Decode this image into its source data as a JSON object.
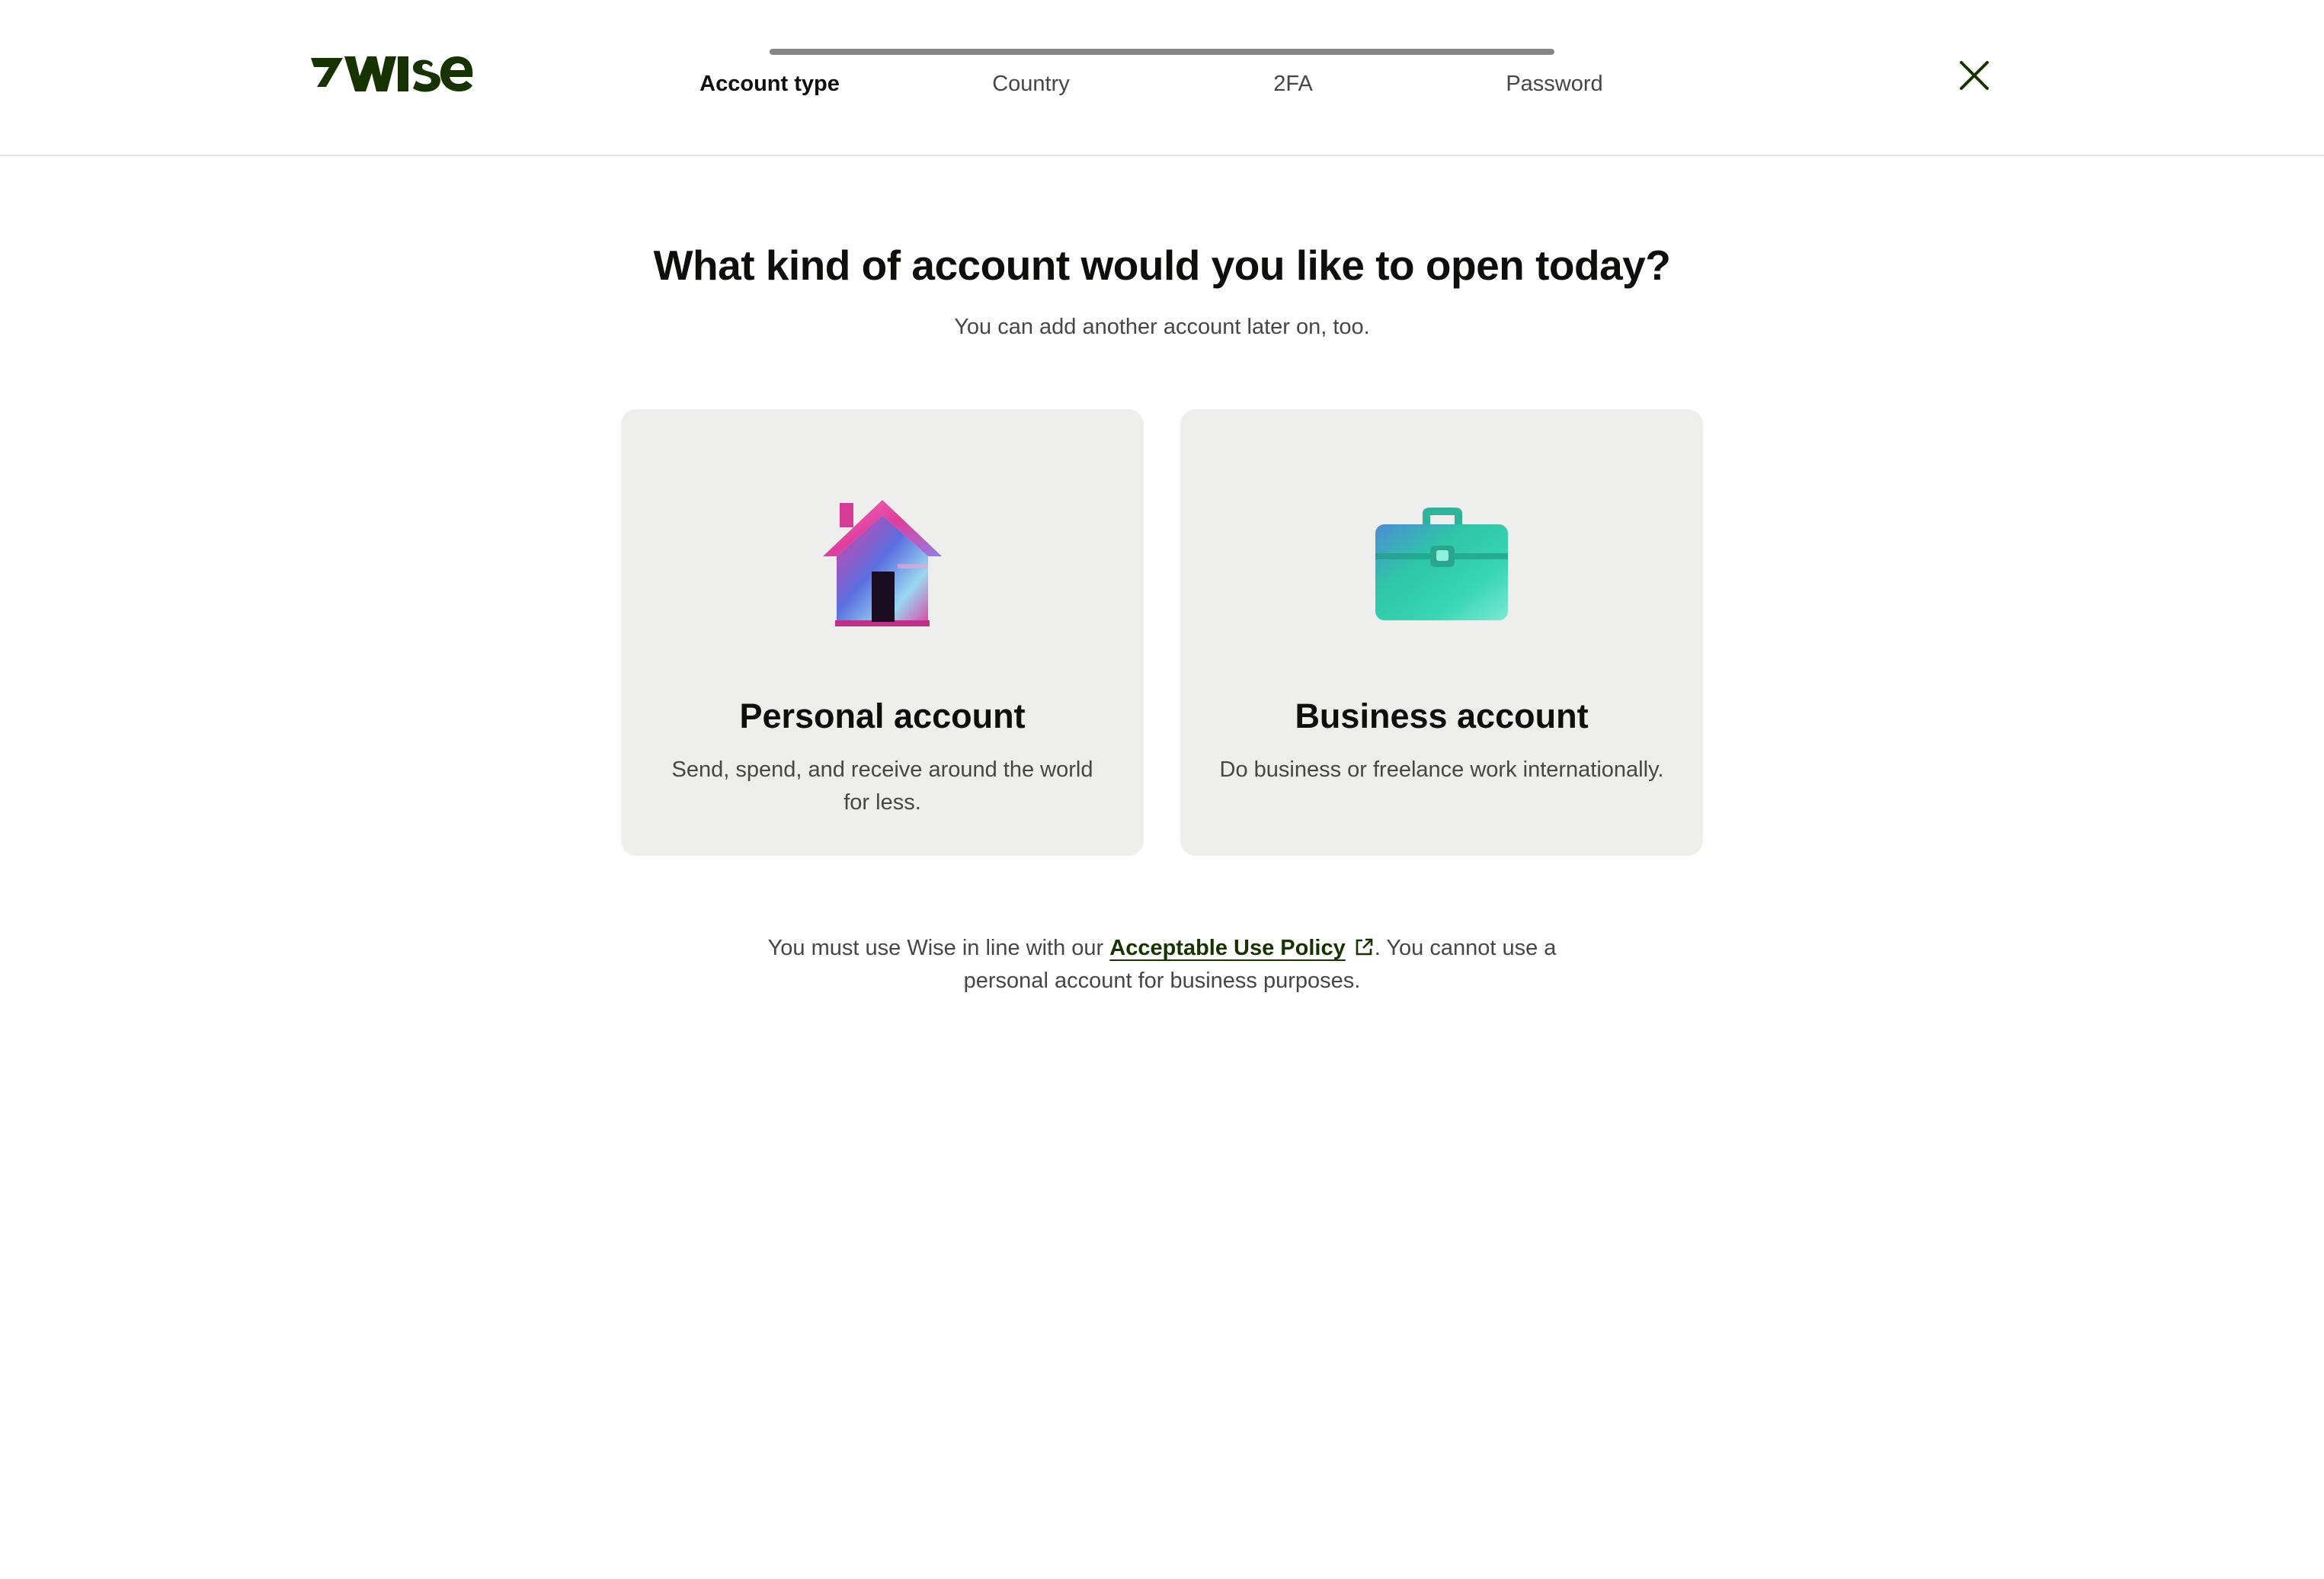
{
  "header": {
    "logo_text": "7WISE",
    "steps": [
      {
        "label": "Account type",
        "active": true
      },
      {
        "label": "Country",
        "active": false
      },
      {
        "label": "2FA",
        "active": false
      },
      {
        "label": "Password",
        "active": false
      }
    ],
    "close_icon": "close-icon"
  },
  "main": {
    "title": "What kind of account would you like to open today?",
    "subtitle": "You can add another account later on, too.",
    "cards": [
      {
        "title": "Personal account",
        "description": "Send, spend, and receive around the world for less.",
        "icon": "house-illustration"
      },
      {
        "title": "Business account",
        "description": "Do business or freelance work internationally.",
        "icon": "briefcase-illustration"
      }
    ],
    "policy": {
      "before": "You must use Wise in line with our ",
      "link_label": "Acceptable Use Policy",
      "after": ". You cannot use a personal account for business purposes.",
      "link_icon": "external-link-icon"
    }
  },
  "colors": {
    "brand_dark_green": "#163300",
    "card_background": "#eeefec",
    "progress_track": "#868685"
  }
}
